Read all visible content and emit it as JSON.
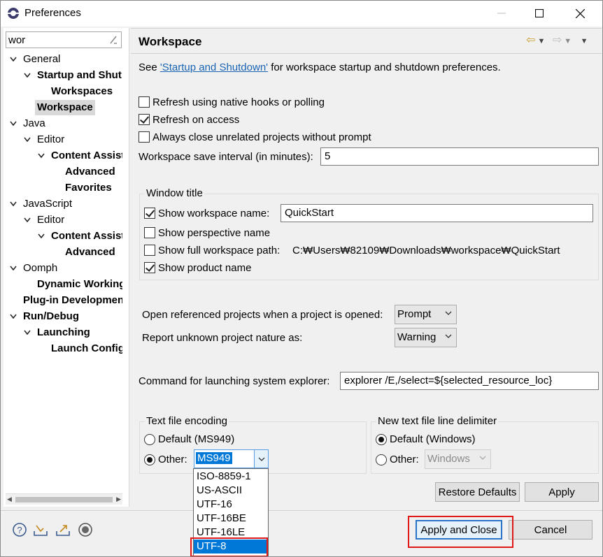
{
  "window": {
    "title": "Preferences"
  },
  "filter": {
    "value": "wor"
  },
  "tree": [
    {
      "label": "General",
      "bold": false,
      "indent": 0,
      "expanded": true,
      "twisty": true
    },
    {
      "label": "Startup and Shut",
      "bold": true,
      "indent": 1,
      "expanded": true,
      "twisty": true
    },
    {
      "label": "Workspaces",
      "bold": true,
      "indent": 2,
      "twisty": false
    },
    {
      "label": "Workspace",
      "bold": true,
      "indent": 1,
      "twisty": false,
      "selected": true
    },
    {
      "label": "Java",
      "bold": false,
      "indent": 0,
      "expanded": true,
      "twisty": true
    },
    {
      "label": "Editor",
      "bold": false,
      "indent": 1,
      "expanded": true,
      "twisty": true
    },
    {
      "label": "Content Assist",
      "bold": true,
      "indent": 2,
      "expanded": true,
      "twisty": true
    },
    {
      "label": "Advanced",
      "bold": true,
      "indent": 3,
      "twisty": false
    },
    {
      "label": "Favorites",
      "bold": true,
      "indent": 3,
      "twisty": false
    },
    {
      "label": "JavaScript",
      "bold": false,
      "indent": 0,
      "expanded": true,
      "twisty": true
    },
    {
      "label": "Editor",
      "bold": false,
      "indent": 1,
      "expanded": true,
      "twisty": true
    },
    {
      "label": "Content Assist",
      "bold": true,
      "indent": 2,
      "expanded": true,
      "twisty": true
    },
    {
      "label": "Advanced",
      "bold": true,
      "indent": 3,
      "twisty": false
    },
    {
      "label": "Oomph",
      "bold": false,
      "indent": 0,
      "expanded": true,
      "twisty": true
    },
    {
      "label": "Dynamic Working",
      "bold": true,
      "indent": 1,
      "twisty": false
    },
    {
      "label": "Plug-in Developmen",
      "bold": true,
      "indent": 0,
      "twisty": false
    },
    {
      "label": "Run/Debug",
      "bold": true,
      "indent": 0,
      "expanded": true,
      "twisty": true
    },
    {
      "label": "Launching",
      "bold": true,
      "indent": 1,
      "expanded": true,
      "twisty": true
    },
    {
      "label": "Launch Config",
      "bold": true,
      "indent": 2,
      "twisty": false
    }
  ],
  "page": {
    "heading": "Workspace",
    "see_prefix": "See ",
    "see_link": "'Startup and Shutdown'",
    "see_suffix": " for workspace startup and shutdown preferences.",
    "refresh_native": "Refresh using native hooks or polling",
    "refresh_native_checked": false,
    "refresh_access": "Refresh on access",
    "refresh_access_checked": true,
    "always_close": "Always close unrelated projects without prompt",
    "always_close_checked": false,
    "save_interval_label": "Workspace save interval (in minutes):",
    "save_interval_value": "5",
    "window_title_group": "Window title",
    "show_ws_name": "Show workspace name:",
    "show_ws_name_checked": true,
    "ws_name_value": "QuickStart",
    "show_perspective": "Show perspective name",
    "show_perspective_checked": false,
    "show_full_path": "Show full workspace path:",
    "show_full_path_checked": false,
    "full_path_value": "C:₩Users₩82109₩Downloads₩workspace₩QuickStart",
    "show_product": "Show product name",
    "show_product_checked": true,
    "open_ref_label": "Open referenced projects when a project is opened:",
    "open_ref_value": "Prompt",
    "report_nature_label": "Report unknown project nature as:",
    "report_nature_value": "Warning",
    "cmd_label": "Command for launching system explorer:",
    "cmd_value": "explorer /E,/select=${selected_resource_loc}",
    "encoding_group": "Text file encoding",
    "default_enc": "Default (MS949)",
    "other_enc": "Other:",
    "other_enc_value": "MS949",
    "delimiter_group": "New text file line delimiter",
    "default_delim": "Default (Windows)",
    "other_delim": "Other:",
    "other_delim_value": "Windows",
    "encoding_options": [
      "ISO-8859-1",
      "US-ASCII",
      "UTF-16",
      "UTF-16BE",
      "UTF-16LE",
      "UTF-8"
    ],
    "highlighted_option": "UTF-8"
  },
  "buttons": {
    "restore_defaults": "Restore Defaults",
    "apply": "Apply",
    "apply_and_close": "Apply and Close",
    "cancel": "Cancel"
  },
  "colors": {
    "link": "#1a64b4",
    "highlight_box": "#e01818",
    "default_button": "#2a73c9"
  }
}
